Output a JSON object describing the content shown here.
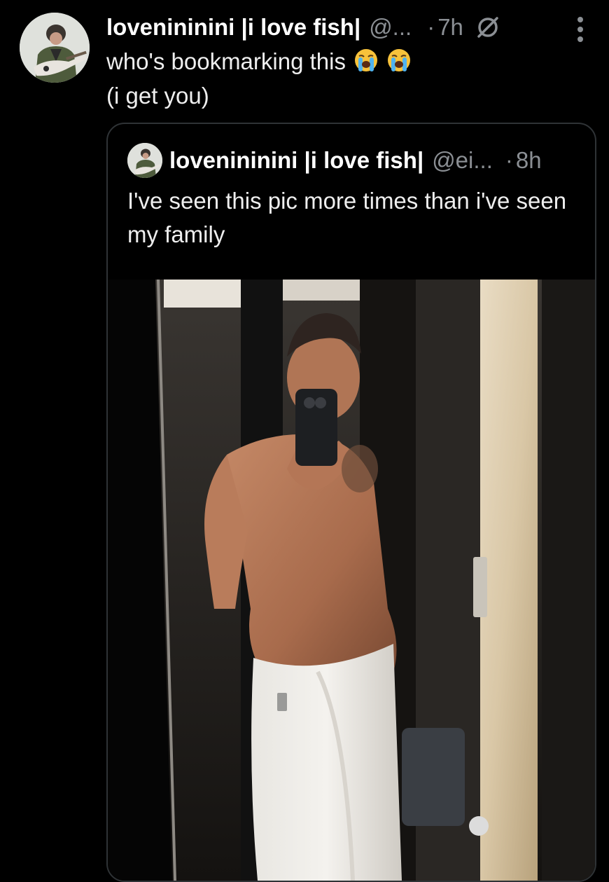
{
  "post": {
    "author": {
      "display_name": "lovenininini |i love fish|",
      "handle": "@...",
      "avatar_icon": "user-avatar-guitar"
    },
    "separator": "·",
    "time": "7h",
    "text_line1": "who's bookmarking this",
    "text_line2": "(i get you)",
    "emojis": [
      "loudly-crying-face",
      "loudly-crying-face"
    ],
    "quoted": {
      "author": {
        "display_name": "lovenininini |i love fish|",
        "handle": "@ei...",
        "avatar_icon": "user-avatar-guitar"
      },
      "separator": "·",
      "time": "8h",
      "text": "I've seen this pic more times than i've seen my family",
      "media": "mirror-selfie-photo"
    }
  },
  "colors": {
    "background": "#000000",
    "text": "#e7e9ea",
    "secondary": "#8b8f94",
    "border": "#2f3336"
  }
}
